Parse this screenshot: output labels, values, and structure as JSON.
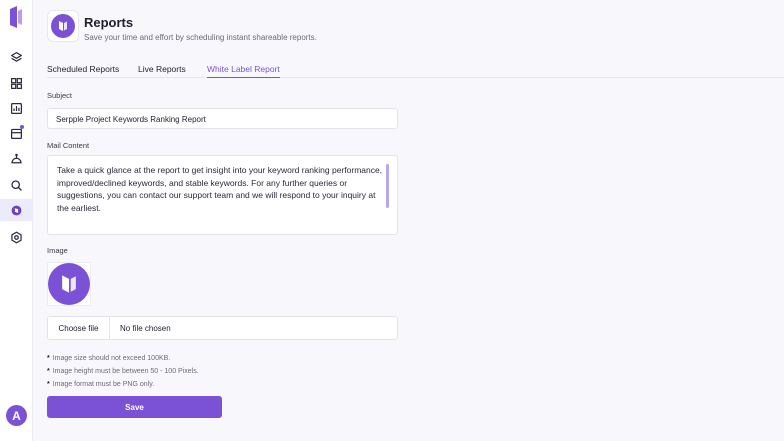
{
  "colors": {
    "accent": "#7b52d6",
    "active_bg": "#ecebfb"
  },
  "sidebar": {
    "items": [
      {
        "icon": "layers-icon"
      },
      {
        "icon": "grid-icon"
      },
      {
        "icon": "bar-chart-icon"
      },
      {
        "icon": "calendar-icon"
      },
      {
        "icon": "robot-icon"
      },
      {
        "icon": "search-icon"
      },
      {
        "icon": "report-icon",
        "active": true
      },
      {
        "icon": "settings-icon"
      }
    ],
    "avatar_initial": "A"
  },
  "header": {
    "title": "Reports",
    "subtitle": "Save your time and effort by scheduling instant shareable reports."
  },
  "tabs": [
    {
      "label": "Scheduled Reports"
    },
    {
      "label": "Live Reports"
    },
    {
      "label": "White Label Report",
      "active": true
    }
  ],
  "form": {
    "subject_label": "Subject",
    "subject_value": "Serpple Project Keywords Ranking Report",
    "mail_label": "Mail Content",
    "mail_value": "Take a quick glance at the report to get insight into your keyword ranking performance, improved/declined keywords, and stable keywords. For any further queries or suggestions, you can contact our support team and we will respond to your inquiry at the earliest.",
    "image_label": "Image",
    "choose_file_label": "Choose file",
    "file_status": "No file chosen",
    "notes": [
      "Image size should not exceed 100KB.",
      "Image height must be between 50 - 100 Pixels.",
      "Image format must be PNG only."
    ],
    "save_label": "Save"
  }
}
